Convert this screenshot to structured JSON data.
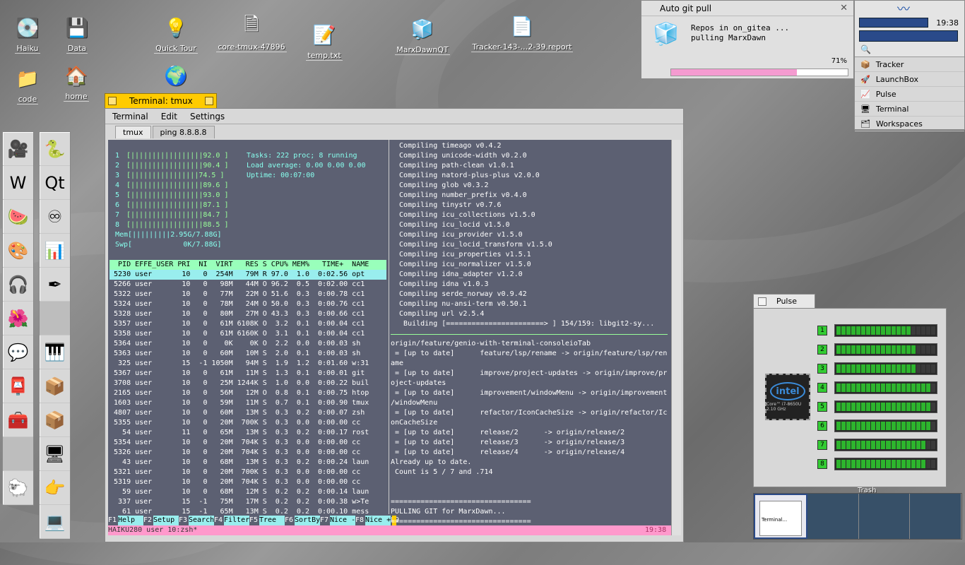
{
  "desktop": {
    "icons": [
      {
        "label": "Haiku",
        "icon": "haiku-disk-icon"
      },
      {
        "label": "Data",
        "icon": "data-disk-icon"
      },
      {
        "label": "Quick Tour",
        "icon": "lightbulb-icon"
      },
      {
        "label": "core-tmux-47896",
        "icon": "file-icon"
      },
      {
        "label": "temp.txt",
        "icon": "text-file-icon"
      },
      {
        "label": "MarxDawnQT",
        "icon": "app-cubes-icon"
      },
      {
        "label": "Tracker-143-…2-39.report",
        "icon": "report-file-icon"
      },
      {
        "label": "code",
        "icon": "folder-icon"
      },
      {
        "label": "home",
        "icon": "home-folder-icon"
      }
    ],
    "trash_label": "Trash"
  },
  "dock_left": [
    "webcam-icon",
    "wiki-icon",
    "game-icon",
    "paint-icon",
    "headphones-icon",
    "flower-icon",
    "chat-icon",
    "mail-icon",
    "tools-icon",
    "",
    "sheep-icon"
  ],
  "dock_right": [
    "snake-icon",
    "qt-icon",
    "infinity-icon",
    "chart-icon",
    "pen-icon",
    "",
    "piano-icon",
    "package-icon",
    "package-icon",
    "terminal-icon",
    "hand-icon",
    "computer-icon"
  ],
  "terminal": {
    "title": "Terminal: tmux",
    "menu": [
      "Terminal",
      "Edit",
      "Settings"
    ],
    "tabs": [
      "tmux",
      "ping 8.8.8.8"
    ],
    "htop": {
      "cpus": [
        {
          "n": "1",
          "bar": "[|||||||||||||||||92.0 ]"
        },
        {
          "n": "2",
          "bar": "[|||||||||||||||||90.4 ]"
        },
        {
          "n": "3",
          "bar": "[||||||||||||||||74.5 ]"
        },
        {
          "n": "4",
          "bar": "[|||||||||||||||||89.6 ]"
        },
        {
          "n": "5",
          "bar": "[|||||||||||||||||93.0 ]"
        },
        {
          "n": "6",
          "bar": "[|||||||||||||||||87.1 ]"
        },
        {
          "n": "7",
          "bar": "[|||||||||||||||||84.7 ]"
        },
        {
          "n": "8",
          "bar": "[|||||||||||||||||88.5 ]"
        }
      ],
      "mem": "Mem[|||||||||2.95G/7.88G]",
      "swp": "Swp[            0K/7.88G]",
      "tasks": "Tasks: 222 proc; 8 running",
      "load": "Load average: 0.00 0.00 0.00",
      "uptime": "Uptime: 00:07:00",
      "header": "  PID EFFE_USER PRI  NI  VIRT   RES S CPU% MEM%   TIME+  NAME",
      "rows": [
        " 5230 user       10   0  254M   79M R 97.0  1.0  0:02.56 opt",
        " 5266 user       10   0   98M   44M O 96.2  0.5  0:02.00 cc1",
        " 5322 user       10   0   77M   22M O 51.6  0.3  0:00.78 cc1",
        " 5324 user       10   0   78M   24M O 50.0  0.3  0:00.76 cc1",
        " 5328 user       10   0   80M   27M O 43.3  0.3  0:00.66 cc1",
        " 5357 user       10   0   61M 6108K O  3.2  0.1  0:00.04 cc1",
        " 5358 user       10   0   61M 6160K O  3.1  0.1  0:00.04 cc1",
        " 5364 user       10   0    0K    0K O  2.2  0.0  0:00.03 sh",
        " 5363 user       10   0   60M   10M S  2.0  0.1  0:00.03 sh",
        "  325 user       15  -1 1050M   94M S  1.9  1.2  0:01.60 w:31",
        " 5367 user       10   0   61M   11M S  1.3  0.1  0:00.01 git",
        " 3708 user       10   0   25M 1244K S  1.0  0.0  0:00.22 buil",
        " 2165 user       10   0   56M   12M O  0.8  0.1  0:00.75 htop",
        " 1603 user       10   0   59M   11M S  0.7  0.1  0:00.90 tmux",
        " 4807 user       10   0   60M   13M S  0.3  0.2  0:00.07 zsh",
        " 5355 user       10   0   20M  700K S  0.3  0.0  0:00.00 cc",
        "   54 user       11   0   65M   13M S  0.3  0.2  0:00.17 rost",
        " 5354 user       10   0   20M  704K S  0.3  0.0  0:00.00 cc",
        " 5326 user       10   0   20M  704K S  0.3  0.0  0:00.00 cc",
        "   43 user       10   0   68M   13M S  0.3  0.2  0:00.24 laun",
        " 5321 user       10   0   20M  700K S  0.3  0.0  0:00.00 cc",
        " 5319 user       10   0   20M  704K S  0.3  0.0  0:00.00 cc",
        "   59 user       10   0   68M   12M S  0.2  0.2  0:00.14 laun",
        "  337 user       15  -1   75M   17M S  0.2  0.2  0:00.38 w>Te",
        "   61 user       15  -1   65M   13M S  0.2  0.2  0:00.10 mess"
      ],
      "fkeys": [
        {
          "k": "F1",
          "l": "Help  "
        },
        {
          "k": "F2",
          "l": "Setup "
        },
        {
          "k": "F3",
          "l": "Search"
        },
        {
          "k": "F4",
          "l": "Filter"
        },
        {
          "k": "F5",
          "l": "Tree  "
        },
        {
          "k": "F6",
          "l": "SortBy"
        },
        {
          "k": "F7",
          "l": "Nice -"
        },
        {
          "k": "F8",
          "l": "Nice +"
        },
        {
          "k": "F9",
          "l": ""
        }
      ]
    },
    "right_pane": [
      "  Compiling timeago v0.4.2",
      "  Compiling unicode-width v0.2.0",
      "  Compiling path-clean v1.0.1",
      "  Compiling natord-plus-plus v2.0.0",
      "  Compiling glob v0.3.2",
      "  Compiling number_prefix v0.4.0",
      "  Compiling tinystr v0.7.6",
      "  Compiling icu_collections v1.5.0",
      "  Compiling icu_locid v1.5.0",
      "  Compiling icu_provider v1.5.0",
      "  Compiling icu_locid_transform v1.5.0",
      "  Compiling icu_properties v1.5.1",
      "  Compiling icu_normalizer v1.5.0",
      "  Compiling idna_adapter v1.2.0",
      "  Compiling idna v1.0.3",
      "  Compiling serde_norway v0.9.42",
      "  Compiling nu-ansi-term v0.50.1",
      "  Compiling url v2.5.4",
      "   Building [=======================> ] 154/159: libgit2-sy...",
      "",
      "origin/feature/genio-with-terminal-consoleioTab",
      " = [up to date]      feature/lsp/rename -> origin/feature/lsp/ren",
      "ame",
      " = [up to date]      improve/project-updates -> origin/improve/pr",
      "oject-updates",
      " = [up to date]      improvement/windowMenu -> origin/improvement",
      "/windowMenu",
      " = [up to date]      refactor/IconCacheSize -> origin/refactor/Ic",
      "onCacheSize",
      " = [up to date]      release/2      -> origin/release/2",
      " = [up to date]      release/3      -> origin/release/3",
      " = [up to date]      release/4      -> origin/release/4",
      "Already up to date.",
      " Count is 5 / 7 and .714",
      "",
      "",
      "=================================",
      "PULLING GIT for MarxDawn...",
      "================================="
    ],
    "status_left": "HAIKU280 user 10:zsh*",
    "status_right": "19:38"
  },
  "notification": {
    "title": "Auto git pull",
    "line1": "Repos in on_gitea ...",
    "line2": "pulling MarxDawn",
    "percent_label": "71%",
    "progress": 0.71
  },
  "deskbar": {
    "clock": "19:38",
    "items": [
      {
        "label": "Tracker",
        "icon": "tracker-icon"
      },
      {
        "label": "LaunchBox",
        "icon": "rocket-icon"
      },
      {
        "label": "Pulse",
        "icon": "pulse-icon"
      },
      {
        "label": "Terminal",
        "icon": "terminal-icon"
      },
      {
        "label": "Workspaces",
        "icon": "workspaces-icon"
      }
    ]
  },
  "pulse": {
    "title": "Pulse",
    "cpu_brand": "intel",
    "cpu_model": "Core™ i7-8650U 2.10 GHz",
    "cpus": [
      {
        "n": "1",
        "level": 0.75
      },
      {
        "n": "2",
        "level": 0.8
      },
      {
        "n": "3",
        "level": 0.8
      },
      {
        "n": "4",
        "level": 0.95
      },
      {
        "n": "5",
        "level": 0.95
      },
      {
        "n": "6",
        "level": 0.95
      },
      {
        "n": "7",
        "level": 0.9
      },
      {
        "n": "8",
        "level": 0.9
      }
    ]
  },
  "workspaces": {
    "current_window_label": "Terminal..."
  }
}
